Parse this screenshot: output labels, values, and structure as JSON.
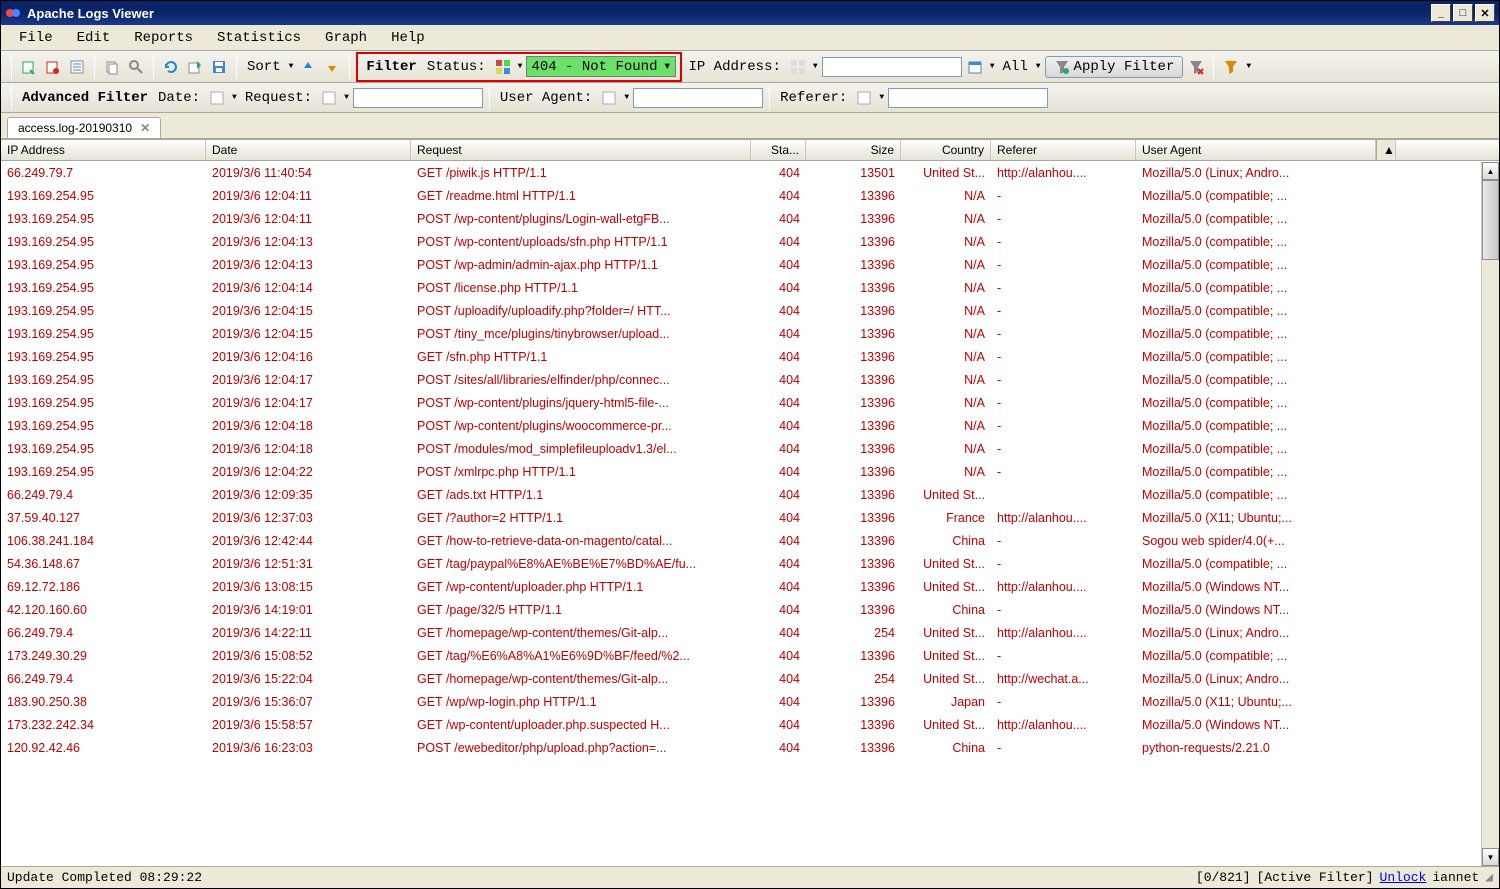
{
  "window": {
    "title": "Apache Logs Viewer"
  },
  "menu": {
    "file": "File",
    "edit": "Edit",
    "reports": "Reports",
    "statistics": "Statistics",
    "graph": "Graph",
    "help": "Help"
  },
  "toolbar": {
    "sort_label": "Sort",
    "filter_label": "Filter",
    "status_label": "Status:",
    "status_value": "404 - Not Found",
    "ip_label": "IP Address:",
    "all_label": "All",
    "apply_label": "Apply Filter"
  },
  "advfilter": {
    "label": "Advanced Filter",
    "date": "Date:",
    "request": "Request:",
    "useragent": "User Agent:",
    "referer": "Referer:"
  },
  "tab": {
    "name": "access.log-20190310"
  },
  "columns": {
    "ip": "IP Address",
    "date": "Date",
    "request": "Request",
    "status": "Sta...",
    "size": "Size",
    "country": "Country",
    "referer": "Referer",
    "ua": "User Agent"
  },
  "rows": [
    {
      "ip": "66.249.79.7",
      "date": "2019/3/6 11:40:54",
      "req": "GET /piwik.js HTTP/1.1",
      "status": "404",
      "size": "13501",
      "country": "United St...",
      "ref": "http://alanhou....",
      "ua": "Mozilla/5.0 (Linux; Andro..."
    },
    {
      "ip": "193.169.254.95",
      "date": "2019/3/6 12:04:11",
      "req": "GET /readme.html HTTP/1.1",
      "status": "404",
      "size": "13396",
      "country": "N/A",
      "ref": "-",
      "ua": "Mozilla/5.0 (compatible; ..."
    },
    {
      "ip": "193.169.254.95",
      "date": "2019/3/6 12:04:11",
      "req": "POST /wp-content/plugins/Login-wall-etgFB...",
      "status": "404",
      "size": "13396",
      "country": "N/A",
      "ref": "-",
      "ua": "Mozilla/5.0 (compatible; ..."
    },
    {
      "ip": "193.169.254.95",
      "date": "2019/3/6 12:04:13",
      "req": "POST /wp-content/uploads/sfn.php HTTP/1.1",
      "status": "404",
      "size": "13396",
      "country": "N/A",
      "ref": "-",
      "ua": "Mozilla/5.0 (compatible; ..."
    },
    {
      "ip": "193.169.254.95",
      "date": "2019/3/6 12:04:13",
      "req": "POST /wp-admin/admin-ajax.php HTTP/1.1",
      "status": "404",
      "size": "13396",
      "country": "N/A",
      "ref": "-",
      "ua": "Mozilla/5.0 (compatible; ..."
    },
    {
      "ip": "193.169.254.95",
      "date": "2019/3/6 12:04:14",
      "req": "POST /license.php HTTP/1.1",
      "status": "404",
      "size": "13396",
      "country": "N/A",
      "ref": "-",
      "ua": "Mozilla/5.0 (compatible; ..."
    },
    {
      "ip": "193.169.254.95",
      "date": "2019/3/6 12:04:15",
      "req": "POST /uploadify/uploadify.php?folder=/ HTT...",
      "status": "404",
      "size": "13396",
      "country": "N/A",
      "ref": "-",
      "ua": "Mozilla/5.0 (compatible; ..."
    },
    {
      "ip": "193.169.254.95",
      "date": "2019/3/6 12:04:15",
      "req": "POST /tiny_mce/plugins/tinybrowser/upload...",
      "status": "404",
      "size": "13396",
      "country": "N/A",
      "ref": "-",
      "ua": "Mozilla/5.0 (compatible; ..."
    },
    {
      "ip": "193.169.254.95",
      "date": "2019/3/6 12:04:16",
      "req": "GET /sfn.php HTTP/1.1",
      "status": "404",
      "size": "13396",
      "country": "N/A",
      "ref": "-",
      "ua": "Mozilla/5.0 (compatible; ..."
    },
    {
      "ip": "193.169.254.95",
      "date": "2019/3/6 12:04:17",
      "req": "POST /sites/all/libraries/elfinder/php/connec...",
      "status": "404",
      "size": "13396",
      "country": "N/A",
      "ref": "-",
      "ua": "Mozilla/5.0 (compatible; ..."
    },
    {
      "ip": "193.169.254.95",
      "date": "2019/3/6 12:04:17",
      "req": "POST /wp-content/plugins/jquery-html5-file-...",
      "status": "404",
      "size": "13396",
      "country": "N/A",
      "ref": "-",
      "ua": "Mozilla/5.0 (compatible; ..."
    },
    {
      "ip": "193.169.254.95",
      "date": "2019/3/6 12:04:18",
      "req": "POST /wp-content/plugins/woocommerce-pr...",
      "status": "404",
      "size": "13396",
      "country": "N/A",
      "ref": "-",
      "ua": "Mozilla/5.0 (compatible; ..."
    },
    {
      "ip": "193.169.254.95",
      "date": "2019/3/6 12:04:18",
      "req": "POST /modules/mod_simplefileuploadv1.3/el...",
      "status": "404",
      "size": "13396",
      "country": "N/A",
      "ref": "-",
      "ua": "Mozilla/5.0 (compatible; ..."
    },
    {
      "ip": "193.169.254.95",
      "date": "2019/3/6 12:04:22",
      "req": "POST /xmlrpc.php HTTP/1.1",
      "status": "404",
      "size": "13396",
      "country": "N/A",
      "ref": "-",
      "ua": "Mozilla/5.0 (compatible; ..."
    },
    {
      "ip": "66.249.79.4",
      "date": "2019/3/6 12:09:35",
      "req": "GET /ads.txt HTTP/1.1",
      "status": "404",
      "size": "13396",
      "country": "United St...",
      "ref": "",
      "ua": "Mozilla/5.0 (compatible; ..."
    },
    {
      "ip": "37.59.40.127",
      "date": "2019/3/6 12:37:03",
      "req": "GET /?author=2 HTTP/1.1",
      "status": "404",
      "size": "13396",
      "country": "France",
      "ref": "http://alanhou....",
      "ua": "Mozilla/5.0 (X11; Ubuntu;..."
    },
    {
      "ip": "106.38.241.184",
      "date": "2019/3/6 12:42:44",
      "req": "GET /how-to-retrieve-data-on-magento/catal...",
      "status": "404",
      "size": "13396",
      "country": "China",
      "ref": "-",
      "ua": "Sogou web spider/4.0(+..."
    },
    {
      "ip": "54.36.148.67",
      "date": "2019/3/6 12:51:31",
      "req": "GET /tag/paypal%E8%AE%BE%E7%BD%AE/fu...",
      "status": "404",
      "size": "13396",
      "country": "United St...",
      "ref": "-",
      "ua": "Mozilla/5.0 (compatible; ..."
    },
    {
      "ip": "69.12.72.186",
      "date": "2019/3/6 13:08:15",
      "req": "GET /wp-content/uploader.php HTTP/1.1",
      "status": "404",
      "size": "13396",
      "country": "United St...",
      "ref": "http://alanhou....",
      "ua": "Mozilla/5.0 (Windows NT..."
    },
    {
      "ip": "42.120.160.60",
      "date": "2019/3/6 14:19:01",
      "req": "GET /page/32/5 HTTP/1.1",
      "status": "404",
      "size": "13396",
      "country": "China",
      "ref": "-",
      "ua": "Mozilla/5.0 (Windows NT..."
    },
    {
      "ip": "66.249.79.4",
      "date": "2019/3/6 14:22:11",
      "req": "GET /homepage/wp-content/themes/Git-alp...",
      "status": "404",
      "size": "254",
      "country": "United St...",
      "ref": "http://alanhou....",
      "ua": "Mozilla/5.0 (Linux; Andro..."
    },
    {
      "ip": "173.249.30.29",
      "date": "2019/3/6 15:08:52",
      "req": "GET /tag/%E6%A8%A1%E6%9D%BF/feed/%2...",
      "status": "404",
      "size": "13396",
      "country": "United St...",
      "ref": "-",
      "ua": "Mozilla/5.0 (compatible; ..."
    },
    {
      "ip": "66.249.79.4",
      "date": "2019/3/6 15:22:04",
      "req": "GET /homepage/wp-content/themes/Git-alp...",
      "status": "404",
      "size": "254",
      "country": "United St...",
      "ref": "http://wechat.a...",
      "ua": "Mozilla/5.0 (Linux; Andro..."
    },
    {
      "ip": "183.90.250.38",
      "date": "2019/3/6 15:36:07",
      "req": "GET /wp/wp-login.php HTTP/1.1",
      "status": "404",
      "size": "13396",
      "country": "Japan",
      "ref": "-",
      "ua": "Mozilla/5.0 (X11; Ubuntu;..."
    },
    {
      "ip": "173.232.242.34",
      "date": "2019/3/6 15:58:57",
      "req": "GET /wp-content/uploader.php.suspected H...",
      "status": "404",
      "size": "13396",
      "country": "United St...",
      "ref": "http://alanhou....",
      "ua": "Mozilla/5.0 (Windows NT..."
    },
    {
      "ip": "120.92.42.46",
      "date": "2019/3/6 16:23:03",
      "req": "POST /ewebeditor/php/upload.php?action=...",
      "status": "404",
      "size": "13396",
      "country": "China",
      "ref": "-",
      "ua": "python-requests/2.21.0"
    }
  ],
  "status": {
    "left": "Update Completed 08:29:22",
    "count": "[0/821]",
    "filter": "[Active Filter]",
    "unlock": "Unlock",
    "user": "iannet"
  }
}
